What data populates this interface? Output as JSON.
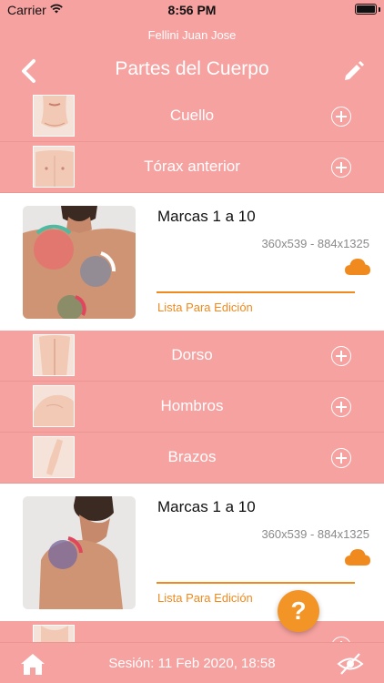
{
  "status_bar": {
    "carrier": "Carrier",
    "time": "8:56 PM"
  },
  "header": {
    "user_name": "Fellini Juan Jose",
    "title": "Partes del Cuerpo"
  },
  "body_parts": [
    {
      "label": "Cuello"
    },
    {
      "label": "Tórax anterior"
    },
    {
      "label": "Dorso"
    },
    {
      "label": "Hombros"
    },
    {
      "label": "Brazos"
    },
    {
      "label": ""
    }
  ],
  "records": [
    {
      "name": "Marcas 1 a 10",
      "dimensions": "360x539 - 884x1325",
      "status": "Lista Para Edición"
    },
    {
      "name": "Marcas 1 a 10",
      "dimensions": "360x539 - 884x1325",
      "status": "Lista Para Edición"
    }
  ],
  "help": {
    "label": "?"
  },
  "footer": {
    "session": "Sesión: 11 Feb 2020, 18:58"
  },
  "colors": {
    "header_pink": "#f6a2a0",
    "accent_orange": "#f08a1e",
    "help_orange": "#f39526"
  }
}
